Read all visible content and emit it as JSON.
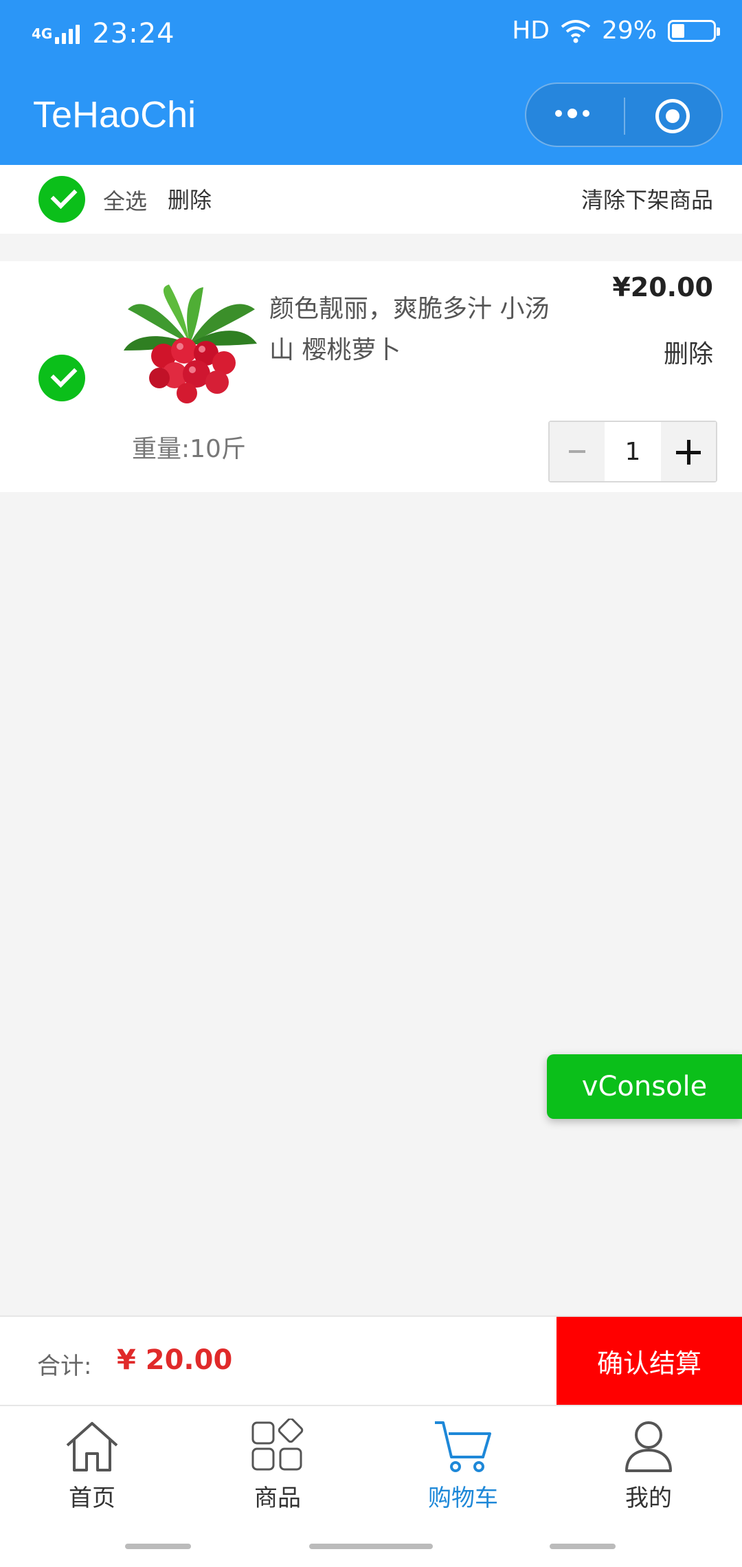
{
  "status_bar": {
    "network": "4G",
    "time": "23:24",
    "hd": "HD",
    "battery": "29%"
  },
  "navbar": {
    "title": "TeHaoChi"
  },
  "select_bar": {
    "select_all": "全选",
    "delete": "删除",
    "clear_offline": "清除下架商品"
  },
  "cart": {
    "items": [
      {
        "name": "颜色靓丽，爽脆多汁 小汤山 樱桃萝卜",
        "price": "¥20.00",
        "delete": "删除",
        "spec": "重量:10斤",
        "quantity": "1"
      }
    ]
  },
  "vconsole": {
    "label": "vConsole"
  },
  "total_bar": {
    "label": "合计:",
    "value": "¥ 20.00",
    "checkout": "确认结算"
  },
  "tabbar": {
    "tabs": [
      {
        "label": "首页"
      },
      {
        "label": "商品"
      },
      {
        "label": "购物车"
      },
      {
        "label": "我的"
      }
    ]
  },
  "colors": {
    "brand": "#2b96f7",
    "check": "#0bbf1a",
    "checkout": "#ff0000",
    "active_tab": "#1e88d8",
    "total_price": "#e02a2a"
  }
}
